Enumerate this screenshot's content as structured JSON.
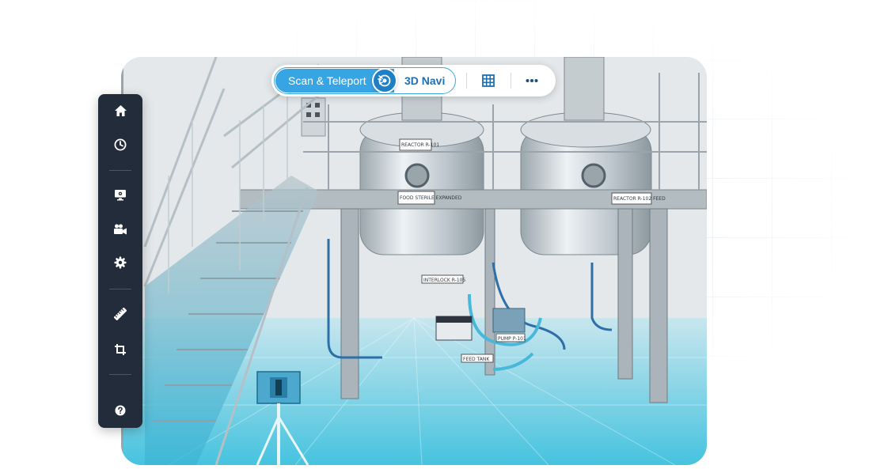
{
  "toolbar": {
    "scan_label": "Scan & Teleport",
    "navi_label": "3D Navi",
    "grid_button_icon": "grid-view-icon",
    "more_button_icon": "more-horizontal-icon",
    "toggle_knob_icon": "navigation-mode-icon"
  },
  "sidebar": {
    "items": [
      {
        "icon": "home-icon"
      },
      {
        "icon": "clock-icon"
      },
      {
        "icon": "monitor-settings-icon"
      },
      {
        "icon": "video-camera-icon"
      },
      {
        "icon": "gear-icon"
      },
      {
        "icon": "ruler-icon"
      },
      {
        "icon": "crop-icon"
      },
      {
        "icon": "help-icon"
      }
    ]
  },
  "viewer": {
    "labels": [
      {
        "text": "REACTOR R-101"
      },
      {
        "text": "FOOD STERILE EXPANDED"
      },
      {
        "text": "REACTOR R-102 FEED"
      },
      {
        "text": "INTERLOCK R-105"
      },
      {
        "text": "PUMP P-101"
      },
      {
        "text": "FEED TANK"
      }
    ]
  },
  "colors": {
    "accent": "#37a5e3",
    "accent_dark": "#1d7fc6",
    "sidebar_bg": "#222c3a",
    "pointcloud_cyan": "#4fc6e0"
  }
}
